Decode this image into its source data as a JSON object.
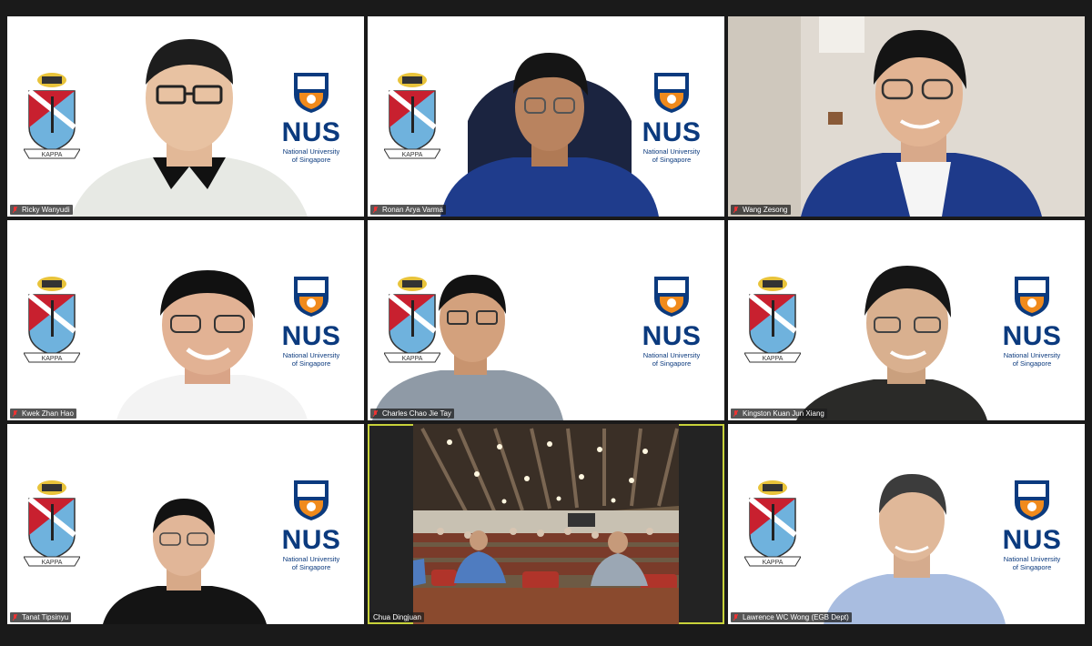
{
  "meeting": {
    "participants": [
      {
        "name": "Ricky Wanyudi"
      },
      {
        "name": "Ronan Arya Varma"
      },
      {
        "name": "Wang Zesong"
      },
      {
        "name": "Kwek Zhan Hao"
      },
      {
        "name": "Charles Chao Jie Tay"
      },
      {
        "name": "Kingston Kuan Jun Xiang"
      },
      {
        "name": "Tanat Tipsinyu"
      },
      {
        "name": "Chua Dingjuan"
      },
      {
        "name": "Lawrence WC Wong (EGB Dept)"
      }
    ],
    "active_speaker_index": 7
  },
  "logos": {
    "nus_wordmark": "NUS",
    "nus_line1": "National University",
    "nus_line2": "of Singapore",
    "crest_banner": "KAPPA"
  },
  "colors": {
    "active_border": "#c8d23a",
    "nus_blue": "#0b3a7e",
    "crest_red": "#c8202f",
    "crest_blue": "#6fb2dd",
    "background": "#1a1a1a"
  },
  "icons": {
    "muted_mic": "mic-muted-icon"
  }
}
